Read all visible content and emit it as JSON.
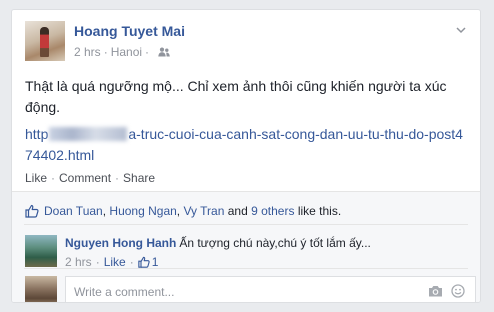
{
  "post": {
    "author": "Hoang Tuyet Mai",
    "time": "2 hrs",
    "separator": "·",
    "location": "Hanoi",
    "text": "Thật là quá ngưỡng mộ... Chỉ xem ảnh thôi cũng khiến người ta xúc động.",
    "link_prefix": "http",
    "link_suffix": "a-truc-cuoi-cua-canh-sat-cong-dan-uu-tu-thu-do-post474402.html",
    "icons": {
      "audience": "friends-icon",
      "menu": "chevron-down-icon"
    }
  },
  "actions": {
    "like": "Like",
    "comment": "Comment",
    "share": "Share",
    "dot": "·"
  },
  "likes": {
    "names": [
      "Doan Tuan",
      "Huong Ngan",
      "Vy Tran"
    ],
    "comma": ",",
    "and": "and",
    "others": "9 others",
    "suffix": "like this."
  },
  "comment": {
    "author": "Nguyen Hong Hanh",
    "text": "Ấn tượng chú này,chú ý tốt lắm ấy...",
    "time": "2 hrs",
    "like": "Like",
    "like_count": "1",
    "dot": "·"
  },
  "composer": {
    "placeholder": "Write a comment..."
  },
  "colors": {
    "link": "#365899",
    "text": "#1d2129",
    "muted": "#90949c",
    "ufi_bg": "#f6f7f9"
  }
}
